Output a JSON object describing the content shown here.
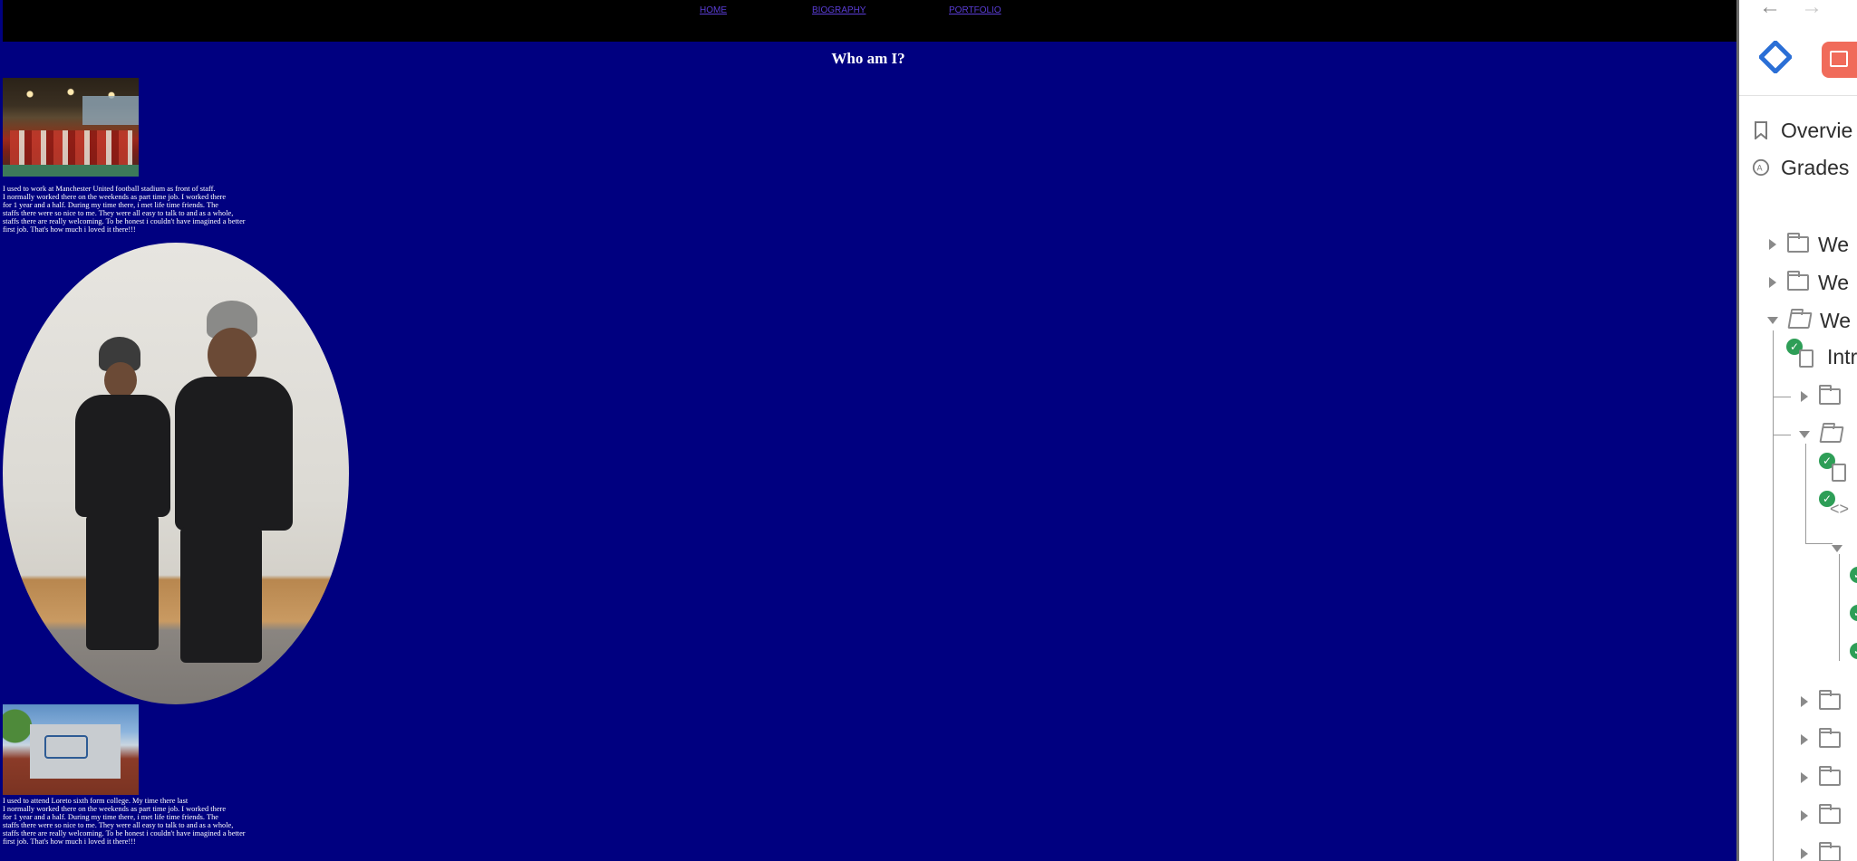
{
  "nav": {
    "home": "HOME",
    "biography": "BIOGRAPHY",
    "portfolio": "PORTFOLIO"
  },
  "page": {
    "title": "Who am I?",
    "paragraph1": "I used to work at Manchester United football stadium as front of staff.\nI normally worked there on the weekends as part time job. I worked there\nfor 1 year and a half. During my time there, i met life time friends. The\nstaffs there were so nice to me. They were all easy to talk to and as a whole,\nstaffs there are really welcoming. To be honest i couldn't have imagined a better\nfirst job. That's how much i loved it there!!!",
    "paragraph2": "I used to attend Loreto sixth form college. My time there last\nI normally worked there on the weekends as part time job. I worked there\nfor 1 year and a half. During my time there, i met life time friends. The\nstaffs there were so nice to me. They were all easy to talk to and as a whole,\nstaffs there are really welcoming. To be honest i couldn't have imagined a better\nfirst job. That's how much i loved it there!!!"
  },
  "side": {
    "back_arrow": "←",
    "forward_arrow": "→",
    "overview": "Overvie",
    "grades": "Grades",
    "week_label": "We",
    "intro_label": "Intr",
    "bookmark_icon": "bookmark-icon",
    "grades_icon": "grades-icon"
  },
  "colors": {
    "page_bg": "#000080",
    "topbar": "#000000",
    "nav_link": "#5a3dd6",
    "check": "#2e9e57"
  }
}
